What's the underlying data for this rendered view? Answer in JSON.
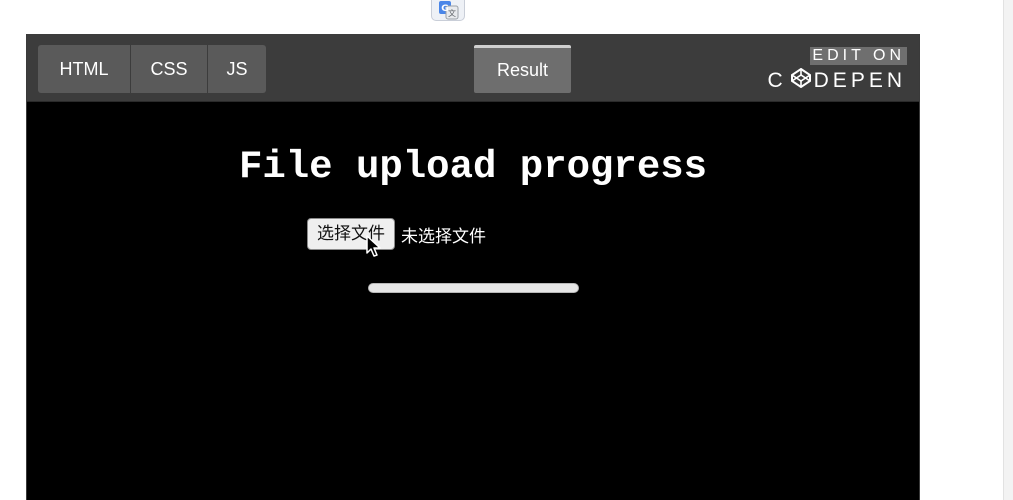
{
  "extension": {
    "icon": "google-translate-icon"
  },
  "embed": {
    "tabs": [
      {
        "label": "HTML",
        "active": false
      },
      {
        "label": "CSS",
        "active": false
      },
      {
        "label": "JS",
        "active": false
      }
    ],
    "result_tab": {
      "label": "Result",
      "active": true
    },
    "edit_on": {
      "label": "EDIT ON",
      "brand_prefix": "C",
      "brand_rest": "DEPEN",
      "logo_icon": "codepen-logo-icon"
    }
  },
  "result": {
    "title": "File upload progress",
    "file_input": {
      "button_label": "选择文件",
      "status": "未选择文件"
    },
    "progress": {
      "value": 0
    },
    "cursor_icon": "mouse-pointer-icon"
  },
  "colors": {
    "header_bg": "#3c3c3c",
    "tab_bg": "#5a5a5a",
    "result_tab_bg": "#6e6e6e",
    "canvas_bg": "#000000"
  }
}
